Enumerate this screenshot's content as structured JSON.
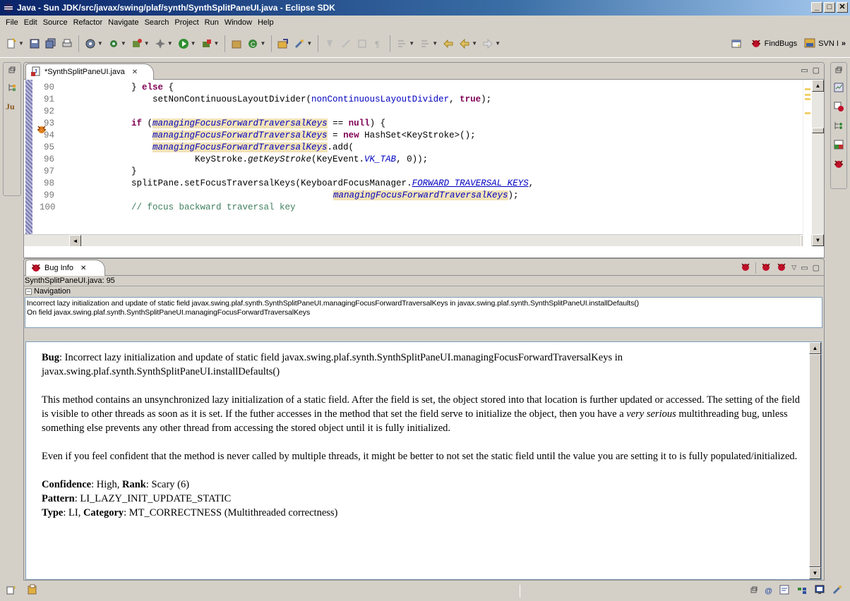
{
  "window": {
    "title": "Java - Sun JDK/src/javax/swing/plaf/synth/SynthSplitPaneUI.java - Eclipse SDK",
    "buttons": [
      "_",
      "□",
      "✕"
    ]
  },
  "menubar": [
    "File",
    "Edit",
    "Source",
    "Refactor",
    "Navigate",
    "Search",
    "Project",
    "Run",
    "Window",
    "Help"
  ],
  "perspectives": {
    "findbugs_label": "FindBugs",
    "svn_label": "SVN I",
    "overflow": "»"
  },
  "editor": {
    "tab_label": "*SynthSplitPaneUI.java",
    "tab_close": "✕",
    "lines": [
      {
        "no": "90"
      },
      {
        "no": "91"
      },
      {
        "no": "92"
      },
      {
        "no": "93"
      },
      {
        "no": "94"
      },
      {
        "no": "95"
      },
      {
        "no": "96"
      },
      {
        "no": "97"
      },
      {
        "no": "98"
      },
      {
        "no": "99"
      },
      {
        "no": "100"
      }
    ],
    "code": {
      "l90_a": "} ",
      "l90_kw": "else",
      "l90_b": " {",
      "l91_a": "setNonContinuousLayoutDivider(",
      "l91_fld": "nonContinuousLayoutDivider",
      "l91_b": ", ",
      "l91_kw": "true",
      "l91_c": ");",
      "l93_kw": "if",
      "l93_a": " (",
      "l93_fld": "managingFocusForwardTraversalKeys",
      "l93_b": " == ",
      "l93_kw2": "null",
      "l93_c": ") {",
      "l94_fld": "managingFocusForwardTraversalKeys",
      "l94_a": " = ",
      "l94_kw": "new",
      "l94_b": " HashSet<KeyStroke>();",
      "l95_fld": "managingFocusForwardTraversalKeys",
      "l95_a": ".add(",
      "l96_a": "KeyStroke.",
      "l96_m": "getKeyStroke",
      "l96_b": "(KeyEvent.",
      "l96_c": "VK_TAB",
      "l96_d": ", 0));",
      "l97_a": "}",
      "l98_a": "splitPane.setFocusTraversalKeys(KeyboardFocusManager.",
      "l98_c": "FORWARD_TRAVERSAL_KEYS",
      "l98_b": ",",
      "l99_fld": "managingFocusForwardTraversalKeys",
      "l99_a": ");",
      "l100_cm": "// focus backward traversal key"
    }
  },
  "buginfo": {
    "tab_label": "Bug Info",
    "tab_close": "✕",
    "location": "SynthSplitPaneUI.java: 95",
    "nav_expander": "−",
    "nav_header": "Navigation",
    "nav_line1": "Incorrect lazy initialization and update of static field javax.swing.plaf.synth.SynthSplitPaneUI.managingFocusForwardTraversalKeys in javax.swing.plaf.synth.SynthSplitPaneUI.installDefaults()",
    "nav_line2": "On field javax.swing.plaf.synth.SynthSplitPaneUI.managingFocusForwardTraversalKeys",
    "bug_label": "Bug",
    "bug_text": ": Incorrect lazy initialization and update of static field javax.swing.plaf.synth.SynthSplitPaneUI.managingFocusForwardTraversalKeys in javax.swing.plaf.synth.SynthSplitPaneUI.installDefaults()",
    "para1_a": "This method contains an unsynchronized lazy initialization of a static field. After the field is set, the object stored into that location is further updated or accessed. The setting of the field is visible to other threads as soon as it is set. If the futher accesses in the method that set the field serve to initialize the object, then you have a ",
    "para1_em": "very serious",
    "para1_b": " multithreading bug, unless something else prevents any other thread from accessing the stored object until it is fully initialized.",
    "para2": "Even if you feel confident that the method is never called by multiple threads, it might be better to not set the static field until the value you are setting it to is fully populated/initialized.",
    "confidence_label": "Confidence",
    "confidence_value": ": High, ",
    "rank_label": "Rank",
    "rank_value": ": Scary (6)",
    "pattern_label": "Pattern",
    "pattern_value": ": LI_LAZY_INIT_UPDATE_STATIC",
    "type_label": "Type",
    "type_value": ": LI, ",
    "category_label": "Category",
    "category_value": ": MT_CORRECTNESS (Multithreaded correctness)"
  },
  "icons": {
    "bug_color": "#c0102a",
    "title_gradient_start": "#0a246a",
    "title_gradient_end": "#a6caf0"
  }
}
